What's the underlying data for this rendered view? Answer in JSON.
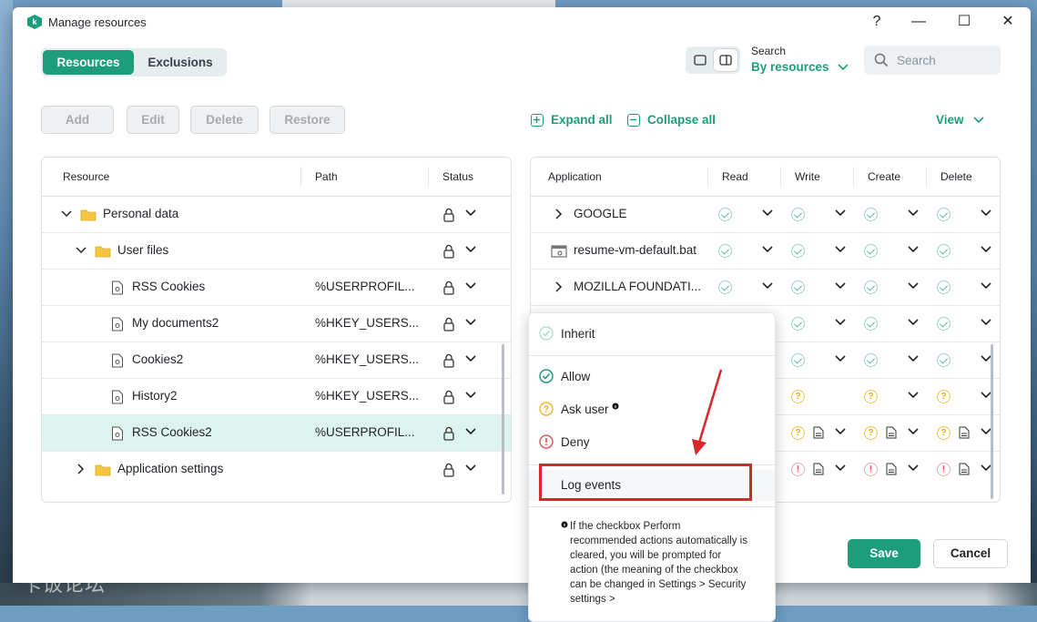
{
  "window": {
    "title": "Manage resources",
    "controls": {
      "help": "?",
      "minimize": "—",
      "maximize": "☐",
      "close": "✕"
    }
  },
  "tabs": [
    {
      "label": "Resources",
      "active": true
    },
    {
      "label": "Exclusions",
      "active": false
    }
  ],
  "search": {
    "label": "Search",
    "mode": "By resources",
    "placeholder": "Search",
    "value": ""
  },
  "actions": {
    "add": "Add",
    "edit": "Edit",
    "delete": "Delete",
    "restore": "Restore",
    "expand_all": "Expand all",
    "collapse_all": "Collapse all",
    "view": "View"
  },
  "resources": {
    "columns": {
      "resource": "Resource",
      "path": "Path",
      "status": "Status"
    },
    "rows": [
      {
        "name": "Personal data",
        "path": "",
        "icon": "folder-icon",
        "expanded": true
      },
      {
        "name": "User files",
        "path": "",
        "icon": "folder-icon",
        "expanded": true
      },
      {
        "name": "RSS Cookies",
        "path": "%USERPROFIL...",
        "icon": "file-icon"
      },
      {
        "name": "My documents2",
        "path": "%HKEY_USERS...",
        "icon": "file-icon"
      },
      {
        "name": "Cookies2",
        "path": "%HKEY_USERS...",
        "icon": "file-icon"
      },
      {
        "name": "History2",
        "path": "%HKEY_USERS...",
        "icon": "file-icon"
      },
      {
        "name": "RSS Cookies2",
        "path": "%USERPROFIL...",
        "icon": "file-icon",
        "selected": true
      },
      {
        "name": "Application settings",
        "path": "",
        "icon": "folder-icon",
        "expanded": false
      }
    ]
  },
  "applications": {
    "columns": {
      "application": "Application",
      "read": "Read",
      "write": "Write",
      "create": "Create",
      "delete": "Delete"
    },
    "rows": [
      {
        "name": "GOOGLE"
      },
      {
        "name": "resume-vm-default.bat"
      },
      {
        "name": "MOZILLA FOUNDATI..."
      }
    ]
  },
  "menu": {
    "items": {
      "inherit": "Inherit",
      "allow": "Allow",
      "ask_user": "Ask user",
      "deny": "Deny",
      "log_events": "Log events"
    },
    "note": "If the checkbox Perform recommended actions automatically is cleared, you will be prompted for action (the meaning of the checkbox can be changed in Settings > Security settings >"
  },
  "footer": {
    "save": "Save",
    "cancel": "Cancel"
  },
  "watermark": "卡饭论坛",
  "colors": {
    "accent": "#1d9d7a",
    "highlight": "#d8262a",
    "allow": "#1d9d7a",
    "ask": "#f2c14e",
    "deny": "#e05a5a"
  }
}
